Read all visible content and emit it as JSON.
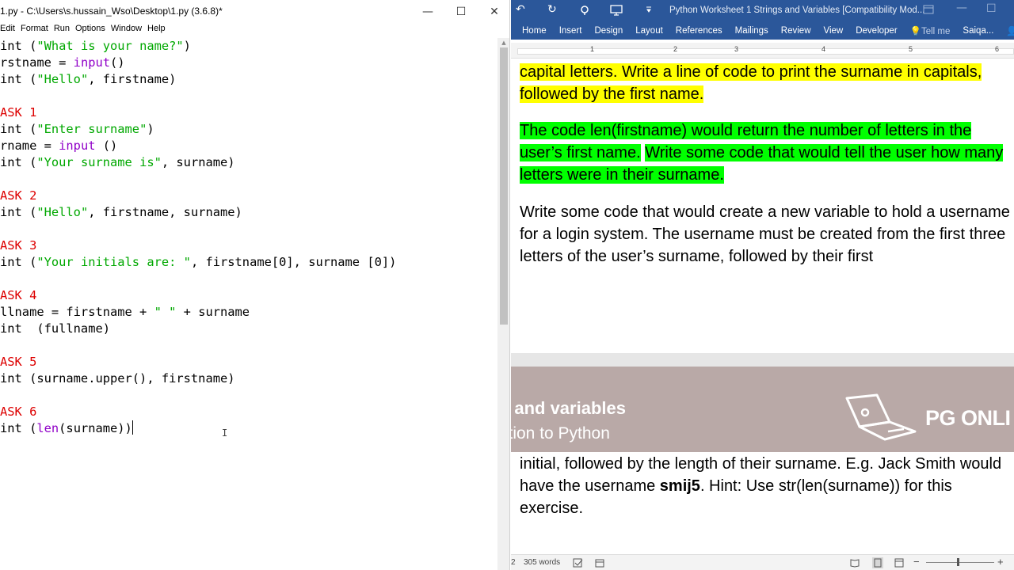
{
  "idle": {
    "title": "1.py - C:\\Users\\s.hussain_Wso\\Desktop\\1.py (3.6.8)*",
    "minimize": "—",
    "maximize": "☐",
    "close": "✕",
    "menu": [
      "Edit",
      "Format",
      "Run",
      "Options",
      "Window",
      "Help"
    ]
  },
  "code_lines": [
    [
      {
        "t": "int (",
        "c": ""
      },
      {
        "t": "\"What is your name?\"",
        "c": "str"
      },
      {
        "t": ")",
        "c": ""
      }
    ],
    [
      {
        "t": "rstname = ",
        "c": ""
      },
      {
        "t": "input",
        "c": "kw"
      },
      {
        "t": "()",
        "c": ""
      }
    ],
    [
      {
        "t": "int (",
        "c": ""
      },
      {
        "t": "\"Hello\"",
        "c": "str"
      },
      {
        "t": ", firstname)",
        "c": ""
      }
    ],
    [],
    [
      {
        "t": "ASK 1",
        "c": "cm"
      }
    ],
    [
      {
        "t": "int (",
        "c": ""
      },
      {
        "t": "\"Enter surname\"",
        "c": "str"
      },
      {
        "t": ")",
        "c": ""
      }
    ],
    [
      {
        "t": "rname = ",
        "c": ""
      },
      {
        "t": "input",
        "c": "kw"
      },
      {
        "t": " ()",
        "c": ""
      }
    ],
    [
      {
        "t": "int (",
        "c": ""
      },
      {
        "t": "\"Your surname is\"",
        "c": "str"
      },
      {
        "t": ", surname)",
        "c": ""
      }
    ],
    [],
    [
      {
        "t": "ASK 2",
        "c": "cm"
      }
    ],
    [
      {
        "t": "int (",
        "c": ""
      },
      {
        "t": "\"Hello\"",
        "c": "str"
      },
      {
        "t": ", firstname, surname)",
        "c": ""
      }
    ],
    [],
    [
      {
        "t": "ASK 3",
        "c": "cm"
      }
    ],
    [
      {
        "t": "int (",
        "c": ""
      },
      {
        "t": "\"Your initials are: \"",
        "c": "str"
      },
      {
        "t": ", firstname[0], surname [0])",
        "c": ""
      }
    ],
    [],
    [
      {
        "t": "ASK 4",
        "c": "cm"
      }
    ],
    [
      {
        "t": "llname = firstname + ",
        "c": ""
      },
      {
        "t": "\" \"",
        "c": "str"
      },
      {
        "t": " + surname",
        "c": ""
      }
    ],
    [
      {
        "t": "int  (fullname)",
        "c": ""
      }
    ],
    [],
    [
      {
        "t": "ASK 5",
        "c": "cm"
      }
    ],
    [
      {
        "t": "int (surname.upper(), firstname)",
        "c": ""
      }
    ],
    [],
    [
      {
        "t": "ASK 6",
        "c": "cm"
      }
    ],
    [
      {
        "t": "int (",
        "c": ""
      },
      {
        "t": "len",
        "c": "kw"
      },
      {
        "t": "(surname))",
        "c": ""
      }
    ]
  ],
  "word": {
    "undo": "↶",
    "redo": "↻",
    "doc_title": "Python Worksheet 1 Strings and Variables [Compatibility Mod...",
    "tabs": [
      "Home",
      "Insert",
      "Design",
      "Layout",
      "References",
      "Mailings",
      "Review",
      "View",
      "Developer",
      "Tell me",
      "Saiqa...",
      "Sh"
    ],
    "ruler_numbers": [
      "1",
      "2",
      "3",
      "4",
      "5",
      "6"
    ],
    "para1": "capital letters. Write a line of code to print the surname in capitals, followed by the first name.",
    "para2a": "The code len(firstname) would return the number of letters in the user’s first name.",
    "para2b": "Write some code that would tell the user how many letters were in their surname.",
    "para3": "Write some code that would create a new variable to hold a username for a login system. The username must be created from the first three letters of the user’s surname, followed by their first",
    "banner_line1": "s and variables",
    "banner_line2": "ction to Python",
    "brand": "PG ONLI",
    "para4_pre": "initial, followed by the length of their surname. E.g. Jack Smith would have the username ",
    "para4_bold": "smij5",
    "para4_post": ". Hint: Use str(len(surname)) for this exercise.",
    "status_page": "2",
    "status_words": "305 words",
    "zoom_minus": "−",
    "zoom_plus": "+"
  }
}
